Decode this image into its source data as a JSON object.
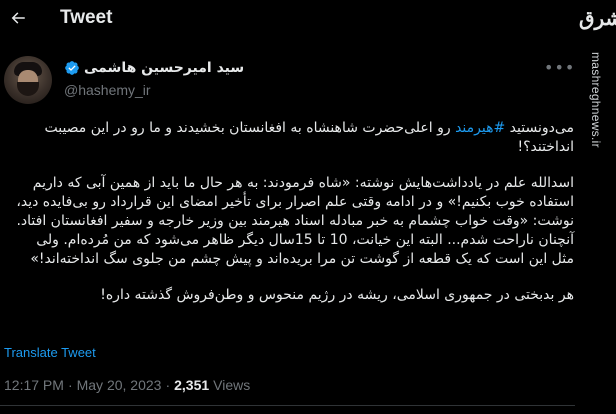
{
  "topbar": {
    "title": "Tweet"
  },
  "watermark": {
    "logo_text": "مشرق",
    "url": "mashreghnews.ir"
  },
  "author": {
    "name": "سید امیرحسین هاشمی",
    "handle": "@hashemy_ir"
  },
  "tweet": {
    "p1_before": "می‌دونستید ",
    "p1_hashtag": "#هیرمند",
    "p1_after": " رو اعلی‌حضرت شاهنشاه به افغانستان بخشیدند و ما رو در این مصیبت انداختند؟!",
    "p2": "اسدالله علم در یادداشت‌هایش نوشته: «شاه فرمودند: به هر حال ما باید از همین آبی که داریم استفاده خوب بکنیم!» و در ادامه وقتی علم اصرار برای تأخیر امضای این قرارداد رو بی‌فایده دید، نوشت: «وقت خواب چشمام به خبر مبادله اسناد هیرمند بین وزیر خارجه و سفیر افغانستان افتاد. آنچنان ناراحت شدم... البته این خیانت، 10 تا 15سال دیگر ظاهر می‌شود که من مُرده‌ام. ولی مثل این است که یک قطعه از گوشت تن مرا بریده‌اند و پیش چشم من جلوی سگ انداخته‌اند!»",
    "p3": "هر بدبختی در جمهوری اسلامی، ریشه در رژیم منحوس و وطن‌فروش گذشته داره!"
  },
  "translate_label": "Translate Tweet",
  "meta": {
    "time": "12:17 PM",
    "sep1": "·",
    "date": "May 20, 2023",
    "sep2": "·",
    "views_count": "2,351",
    "views_label": "Views"
  },
  "colors": {
    "background": "#000000",
    "text": "#e7e9ea",
    "muted": "#71767b",
    "accent": "#1d9bf0"
  },
  "icons": {
    "back": "arrow-left-icon",
    "verified": "verified-badge-icon",
    "more": "more-horizontal-icon"
  }
}
